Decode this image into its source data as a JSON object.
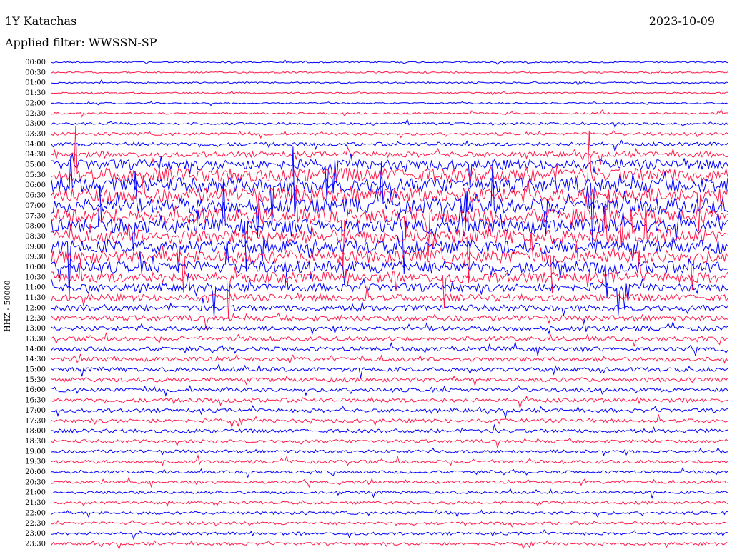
{
  "header": {
    "station": "1Y Katachas",
    "date": "2023-10-09",
    "filter": "Applied filter: WWSSN-SP"
  },
  "chart_data": {
    "type": "line",
    "title": "1Y Katachas",
    "ylabel": "HHZ - 50000",
    "row_labels": [
      "00:00",
      "00:30",
      "01:00",
      "01:30",
      "02:00",
      "02:30",
      "03:00",
      "03:30",
      "04:00",
      "04:30",
      "05:00",
      "05:30",
      "06:00",
      "06:30",
      "07:00",
      "07:30",
      "08:00",
      "08:30",
      "09:00",
      "09:30",
      "10:00",
      "10:30",
      "11:00",
      "11:30",
      "12:00",
      "12:30",
      "13:00",
      "13:30",
      "14:00",
      "14:30",
      "15:00",
      "15:30",
      "16:00",
      "16:30",
      "17:00",
      "17:30",
      "18:00",
      "18:30",
      "19:00",
      "19:30",
      "20:00",
      "20:30",
      "21:00",
      "21:30",
      "22:00",
      "22:30",
      "23:00",
      "23:30"
    ],
    "row_activity": [
      0.3,
      0.3,
      0.3,
      0.3,
      0.3,
      0.4,
      0.5,
      0.6,
      0.8,
      1.2,
      2.2,
      3.0,
      3.2,
      3.3,
      3.3,
      3.2,
      3.1,
      3.0,
      2.9,
      2.8,
      2.6,
      2.3,
      1.7,
      1.5,
      1.3,
      1.2,
      1.0,
      0.9,
      0.9,
      0.9,
      0.9,
      0.9,
      0.85,
      0.85,
      0.8,
      0.8,
      0.8,
      0.7,
      0.7,
      0.7,
      0.6,
      0.6,
      0.6,
      0.6,
      0.6,
      0.6,
      0.6,
      0.6
    ],
    "colors": [
      "#0000ff",
      "#ff1a4a"
    ],
    "grid": false
  }
}
